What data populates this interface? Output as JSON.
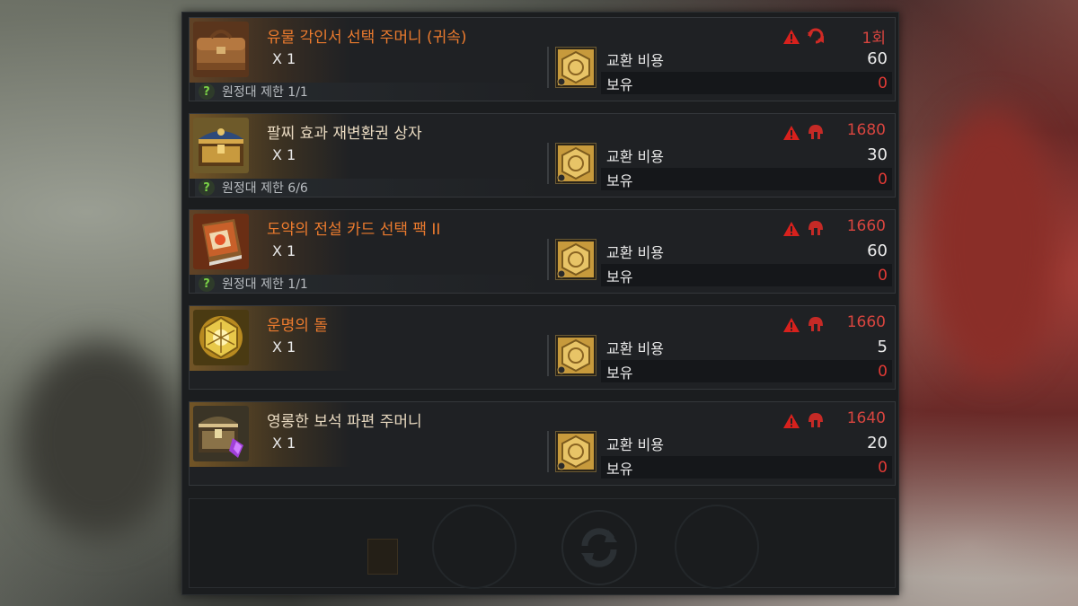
{
  "labels": {
    "cost_label": "교환 비용",
    "owned_label": "보유",
    "help_symbol": "?"
  },
  "colors": {
    "orange_name": "#ea7a2a",
    "white_name": "#e8d9c0",
    "red_value": "#e23a35",
    "limit_green": "#7bd247"
  },
  "items": [
    {
      "name": "유물 각인서 선택 주머니 (귀속)",
      "name_color": "#ec7b2e",
      "quantity": "X 1",
      "limit": "원정대 제한 1/1",
      "icon": "leather-bag-icon",
      "secondary_icon": "bound-refresh-icon",
      "count": "1회",
      "cost": "60",
      "owned": "0"
    },
    {
      "name": "팔찌 효과 재변환권 상자",
      "name_color": "#e8d9c0",
      "quantity": "X 1",
      "limit": "원정대 제한 6/6",
      "icon": "ornate-chest-icon",
      "secondary_icon": "helmet-icon",
      "count": "1680",
      "cost": "30",
      "owned": "0"
    },
    {
      "name": "도약의 전설 카드 선택 팩 II",
      "name_color": "#ec7b2e",
      "quantity": "X 1",
      "limit": "원정대 제한 1/1",
      "icon": "card-book-icon",
      "secondary_icon": "helmet-icon",
      "count": "1660",
      "cost": "60",
      "owned": "0"
    },
    {
      "name": "운명의 돌",
      "name_color": "#ec7b2e",
      "quantity": "X 1",
      "limit": "",
      "icon": "destiny-stone-icon",
      "secondary_icon": "helmet-icon",
      "count": "1660",
      "cost": "5",
      "owned": "0"
    },
    {
      "name": "영롱한 보석 파편 주머니",
      "name_color": "#e8d9c0",
      "quantity": "X 1",
      "limit": "",
      "icon": "gem-chest-icon",
      "secondary_icon": "helmet-icon",
      "count": "1640",
      "cost": "20",
      "owned": "0"
    }
  ]
}
